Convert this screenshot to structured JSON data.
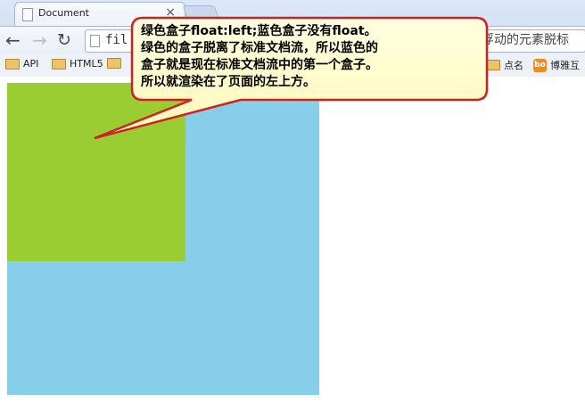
{
  "browser": {
    "tab_title": "Document",
    "tab_close": "×",
    "url_text": "fil",
    "right_partial_text": "浮动的元素脱标"
  },
  "bookmarks": [
    {
      "label": "API",
      "icon": "folder-icon"
    },
    {
      "label": "HTML5",
      "icon": "folder-icon"
    },
    {
      "label": "点名",
      "icon": "folder-icon"
    },
    {
      "label": "博雅互",
      "icon": "bo-badge-icon",
      "badge": "bo"
    }
  ],
  "page": {
    "blue_box_color": "#87ceeb",
    "green_box_color": "#9acd32"
  },
  "callout": {
    "lines": [
      "绿色盒子float:left;蓝色盒子没有float。",
      "绿色的盒子脱离了标准文档流，所以蓝色的",
      "盒子就是现在标准文档流中的第一个盒子。",
      "所以就渲染在了页面的左上方。"
    ],
    "fill_color": "#ffffcc",
    "border_color": "#cc2222"
  }
}
